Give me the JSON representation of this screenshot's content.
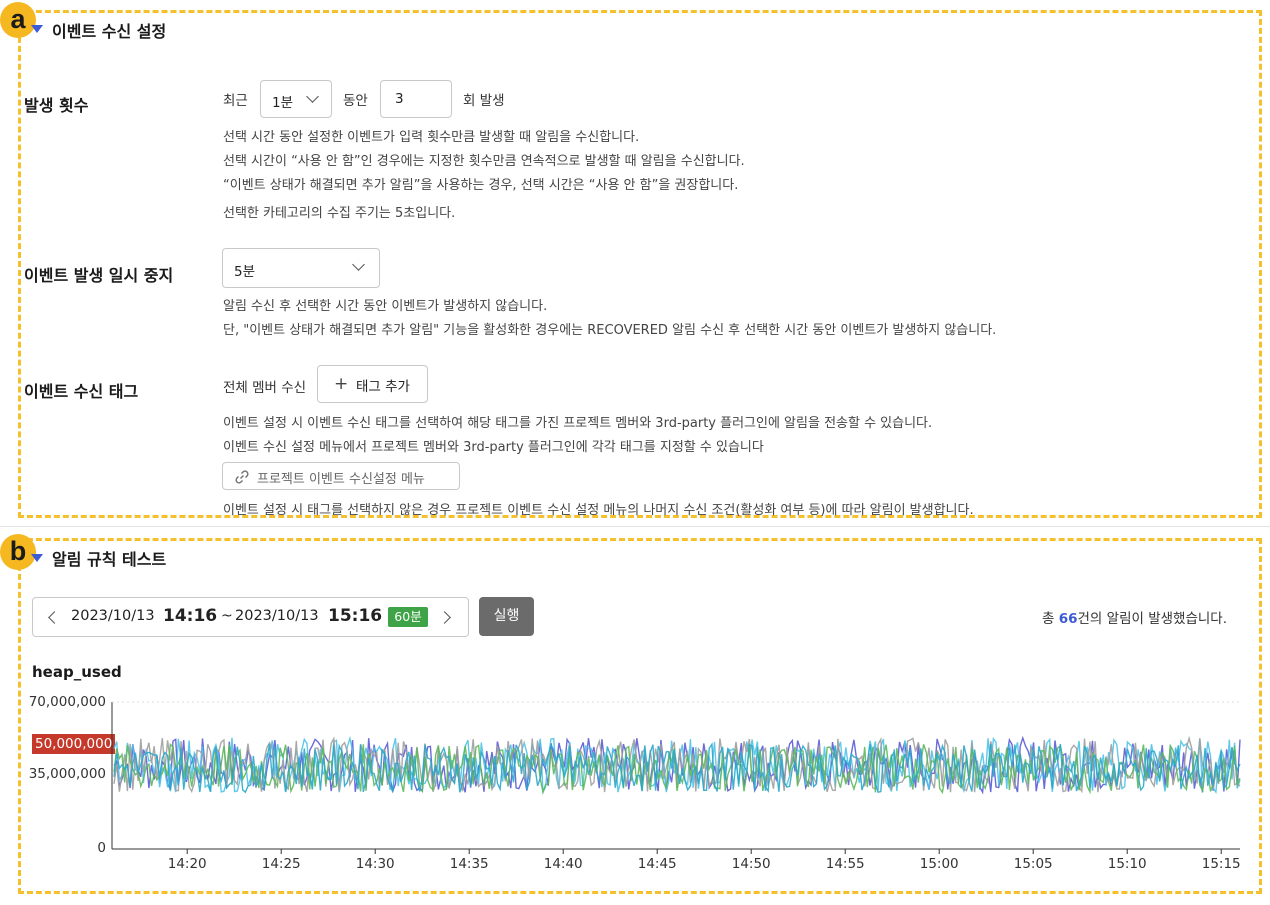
{
  "section_a": {
    "badge": "a",
    "title": "이벤트 수신 설정",
    "occurrence": {
      "label": "발생 횟수",
      "recent_label": "최근",
      "period_value": "1분",
      "during_label": "동안",
      "count_value": "3",
      "count_suffix": "회 발생",
      "help": [
        "선택 시간 동안 설정한 이벤트가 입력 횟수만큼 발생할 때 알림을 수신합니다.",
        "선택 시간이 “사용 안 함”인 경우에는 지정한 횟수만큼 연속적으로 발생할 때 알림을 수신합니다.",
        "“이벤트 상태가 해결되면 추가 알림”을 사용하는 경우, 선택 시간은 “사용 안 함”을 권장합니다.",
        "선택한 카테고리의 수집 주기는 5초입니다."
      ]
    },
    "pause": {
      "label": "이벤트 발생 일시 중지",
      "value": "5분",
      "help": [
        "알림 수신 후 선택한 시간 동안 이벤트가 발생하지 않습니다.",
        "단, \"이벤트 상태가 해결되면 추가 알림\" 기능을 활성화한 경우에는 RECOVERED 알림 수신 후 선택한 시간 동안 이벤트가 발생하지 않습니다."
      ]
    },
    "tags": {
      "label": "이벤트 수신 태그",
      "all_members": "전체 멤버 수신",
      "add_tag": "태그 추가",
      "help": [
        "이벤트 설정 시 이벤트 수신 태그를 선택하여 해당 태그를 가진 프로젝트 멤버와 3rd-party 플러그인에 알림을 전송할 수 있습니다.",
        "이벤트 수신 설정 메뉴에서 프로젝트 멤버와 3rd-party 플러그인에 각각 태그를 지정할 수 있습니다"
      ],
      "menu_link": "프로젝트 이벤트 수신설정 메뉴",
      "footer": "이벤트 설정 시 태그를 선택하지 않은 경우 프로젝트 이벤트 수신 설정 메뉴의 나머지 수신 조건(활성화 여부 등)에 따라 알림이 발생합니다."
    }
  },
  "section_b": {
    "badge": "b",
    "title": "알림 규칙 테스트",
    "range": {
      "start_date": "2023/10/13",
      "start_time": "14:16",
      "sep": "~",
      "end_date": "2023/10/13",
      "end_time": "15:16",
      "duration": "60분"
    },
    "run_label": "실행",
    "summary_prefix": "총 ",
    "summary_count": "66",
    "summary_suffix": "건의 알림이 발생했습니다.",
    "colors": {
      "accent": "#3b5bd6",
      "threshold": "#c5392b",
      "chip": "#3fa447"
    }
  },
  "chart_data": {
    "type": "line",
    "title": "heap_used",
    "ylim": [
      0,
      70000000
    ],
    "yticks": [
      "70,000,000",
      "35,000,000",
      "0"
    ],
    "threshold": {
      "value": 50000000,
      "label": "50,000,000"
    },
    "x_ticks": [
      "14:20",
      "14:25",
      "14:30",
      "14:35",
      "14:40",
      "14:45",
      "14:50",
      "14:55",
      "15:00",
      "15:05",
      "15:10",
      "15:15"
    ],
    "x_range": [
      "14:16",
      "15:16"
    ],
    "series": [
      {
        "color": "#5b5bd6",
        "min": 27000000,
        "max": 53000000
      },
      {
        "color": "#4fc3e8",
        "min": 27000000,
        "max": 53000000
      },
      {
        "color": "#9e9e9e",
        "min": 27000000,
        "max": 53000000
      },
      {
        "color": "#5cb85c",
        "min": 27000000,
        "max": 50000000
      },
      {
        "color": "#2aa7c9",
        "min": 27000000,
        "max": 50000000
      }
    ]
  }
}
